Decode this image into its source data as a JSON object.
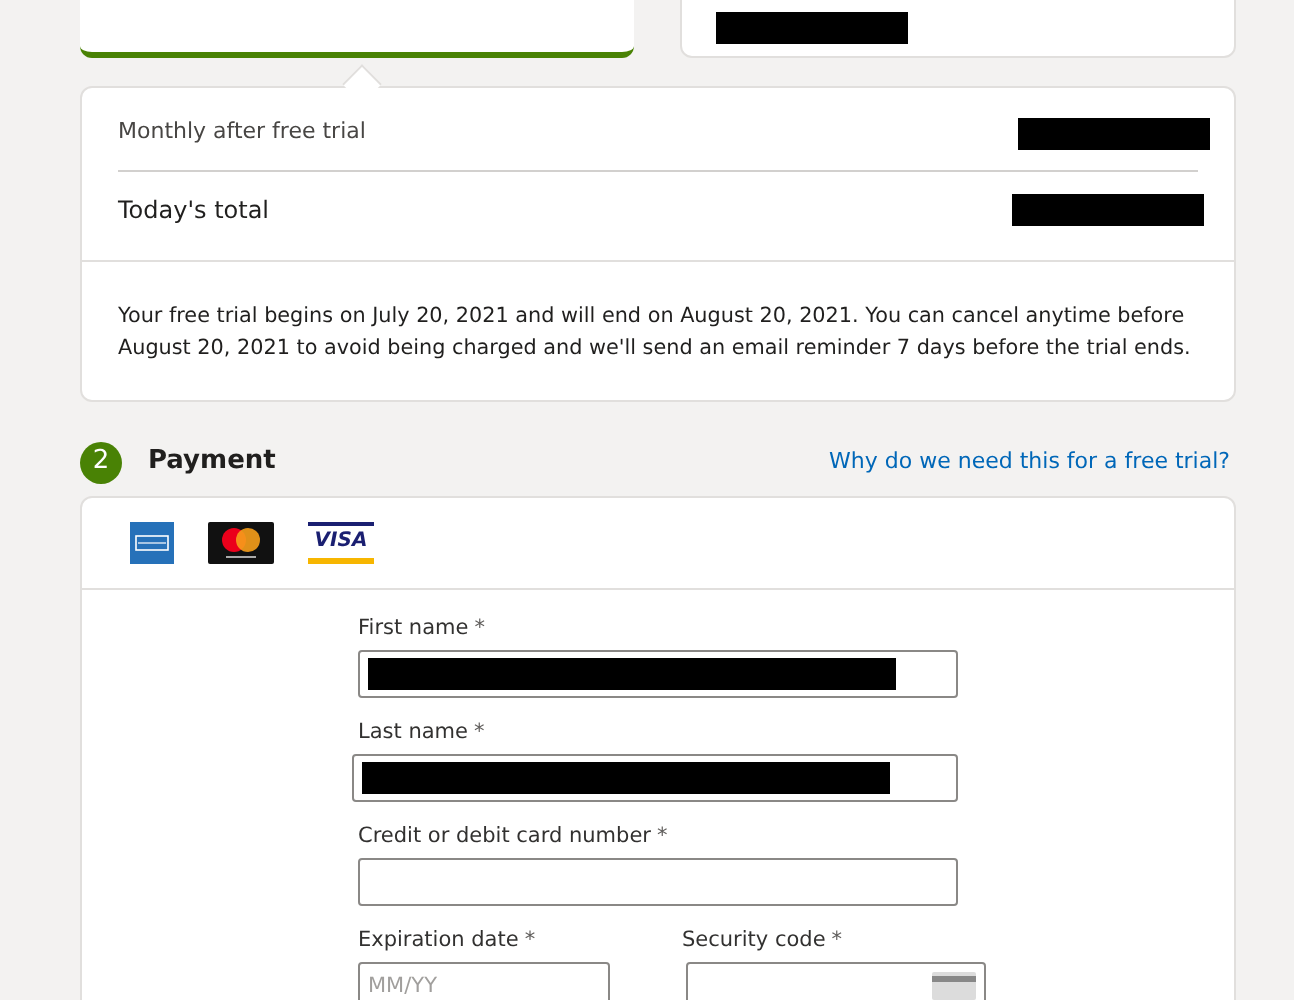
{
  "plans": [
    {
      "selected": true
    },
    {
      "selected": false,
      "redacted": true
    }
  ],
  "summary": {
    "rows": [
      {
        "label": "Monthly after free trial",
        "emphasis": false,
        "redacted": true
      },
      {
        "label": "Today's total",
        "emphasis": true,
        "redacted": true
      }
    ],
    "note": "Your free trial begins on July 20, 2021 and will end on August 20, 2021. You can cancel anytime before August 20, 2021 to avoid being charged and we'll send an email reminder 7 days before the trial ends."
  },
  "payment": {
    "step": "2",
    "title": "Payment",
    "link": "Why do we need this for a free trial?",
    "cards": [
      {
        "kind": "amex"
      },
      {
        "kind": "mastercard"
      },
      {
        "kind": "visa",
        "label": "VISA"
      }
    ],
    "fields": [
      {
        "label": "First name",
        "required": "*",
        "redacted": true
      },
      {
        "label": "Last name",
        "required": "*",
        "redacted": true
      },
      {
        "label": "Credit or debit card number",
        "required": "*"
      },
      {
        "label": "Expiration date",
        "required": "*",
        "placeholder": "MM/YY"
      },
      {
        "label": "Security code",
        "required": "*"
      }
    ]
  }
}
